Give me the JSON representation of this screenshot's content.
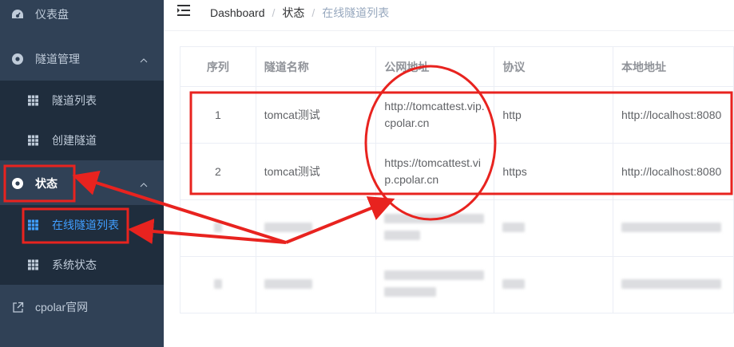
{
  "sidebar": {
    "items": [
      {
        "label": "仪表盘",
        "icon": "dashboard-icon"
      },
      {
        "label": "隧道管理",
        "icon": "gear-icon",
        "expanded": true,
        "children": [
          {
            "label": "隧道列表",
            "icon": "grid-icon"
          },
          {
            "label": "创建隧道",
            "icon": "grid-icon"
          }
        ]
      },
      {
        "label": "状态",
        "icon": "gear-icon",
        "expanded": true,
        "children": [
          {
            "label": "在线隧道列表",
            "icon": "grid-icon",
            "active": true
          },
          {
            "label": "系统状态",
            "icon": "grid-icon"
          }
        ]
      },
      {
        "label": "cpolar官网",
        "icon": "external-link-icon"
      }
    ]
  },
  "header": {
    "breadcrumb": [
      "Dashboard",
      "状态",
      "在线隧道列表"
    ]
  },
  "table": {
    "columns": [
      "序列",
      "隧道名称",
      "公网地址",
      "协议",
      "本地地址"
    ],
    "rows": [
      {
        "index": "1",
        "name": "tomcat测试",
        "public_line1": "http://tomcattest.vip.",
        "public_line2": "cpolar.cn",
        "protocol": "http",
        "local": "http://localhost:8080"
      },
      {
        "index": "2",
        "name": "tomcat测试",
        "public_line1": "https://tomcattest.vi",
        "public_line2": "p.cpolar.cn",
        "protocol": "https",
        "local": "http://localhost:8080"
      }
    ]
  },
  "colors": {
    "sidebar_bg": "#304156",
    "submenu_bg": "#1f2d3d",
    "active": "#409eff",
    "annotation": "#e8231f"
  }
}
